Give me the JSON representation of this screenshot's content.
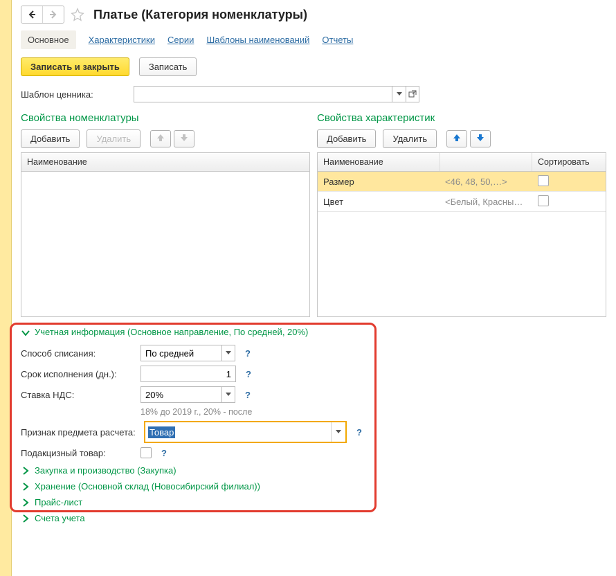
{
  "header": {
    "title": "Платье (Категория номенклатуры)"
  },
  "tabs": {
    "main": "Основное",
    "characteristics": "Характеристики",
    "series": "Серии",
    "naming_templates": "Шаблоны наименований",
    "reports": "Отчеты"
  },
  "toolbar": {
    "save_close": "Записать и закрыть",
    "save": "Записать"
  },
  "template": {
    "label": "Шаблон ценника:",
    "value": ""
  },
  "columns": {
    "left": {
      "title": "Свойства номенклатуры",
      "add": "Добавить",
      "delete": "Удалить",
      "header_name": "Наименование"
    },
    "right": {
      "title": "Свойства характеристик",
      "add": "Добавить",
      "delete": "Удалить",
      "header_name": "Наименование",
      "header_sort": "Сортировать",
      "rows": [
        {
          "name": "Размер",
          "values": "<46, 48, 50,…>",
          "sort": false
        },
        {
          "name": "Цвет",
          "values": "<Белый, Красный , …",
          "sort": false
        }
      ]
    }
  },
  "accounting": {
    "group_title": "Учетная информация (Основное направление, По средней, 20%)",
    "writeoff_label": "Способ списания:",
    "writeoff_value": "По средней",
    "term_label": "Срок исполнения (дн.):",
    "term_value": "1",
    "vat_label": "Ставка НДС:",
    "vat_value": "20%",
    "vat_hint": "18% до 2019 г., 20% - после",
    "subject_label": "Признак предмета расчета:",
    "subject_value": "Товар",
    "excise_label": "Подакцизный товар:"
  },
  "collapsed_groups": {
    "purchase": "Закупка и производство (Закупка)",
    "storage": "Хранение (Основной склад (Новосибирский филиал))",
    "price": "Прайс-лист",
    "accounts": "Счета учета"
  }
}
